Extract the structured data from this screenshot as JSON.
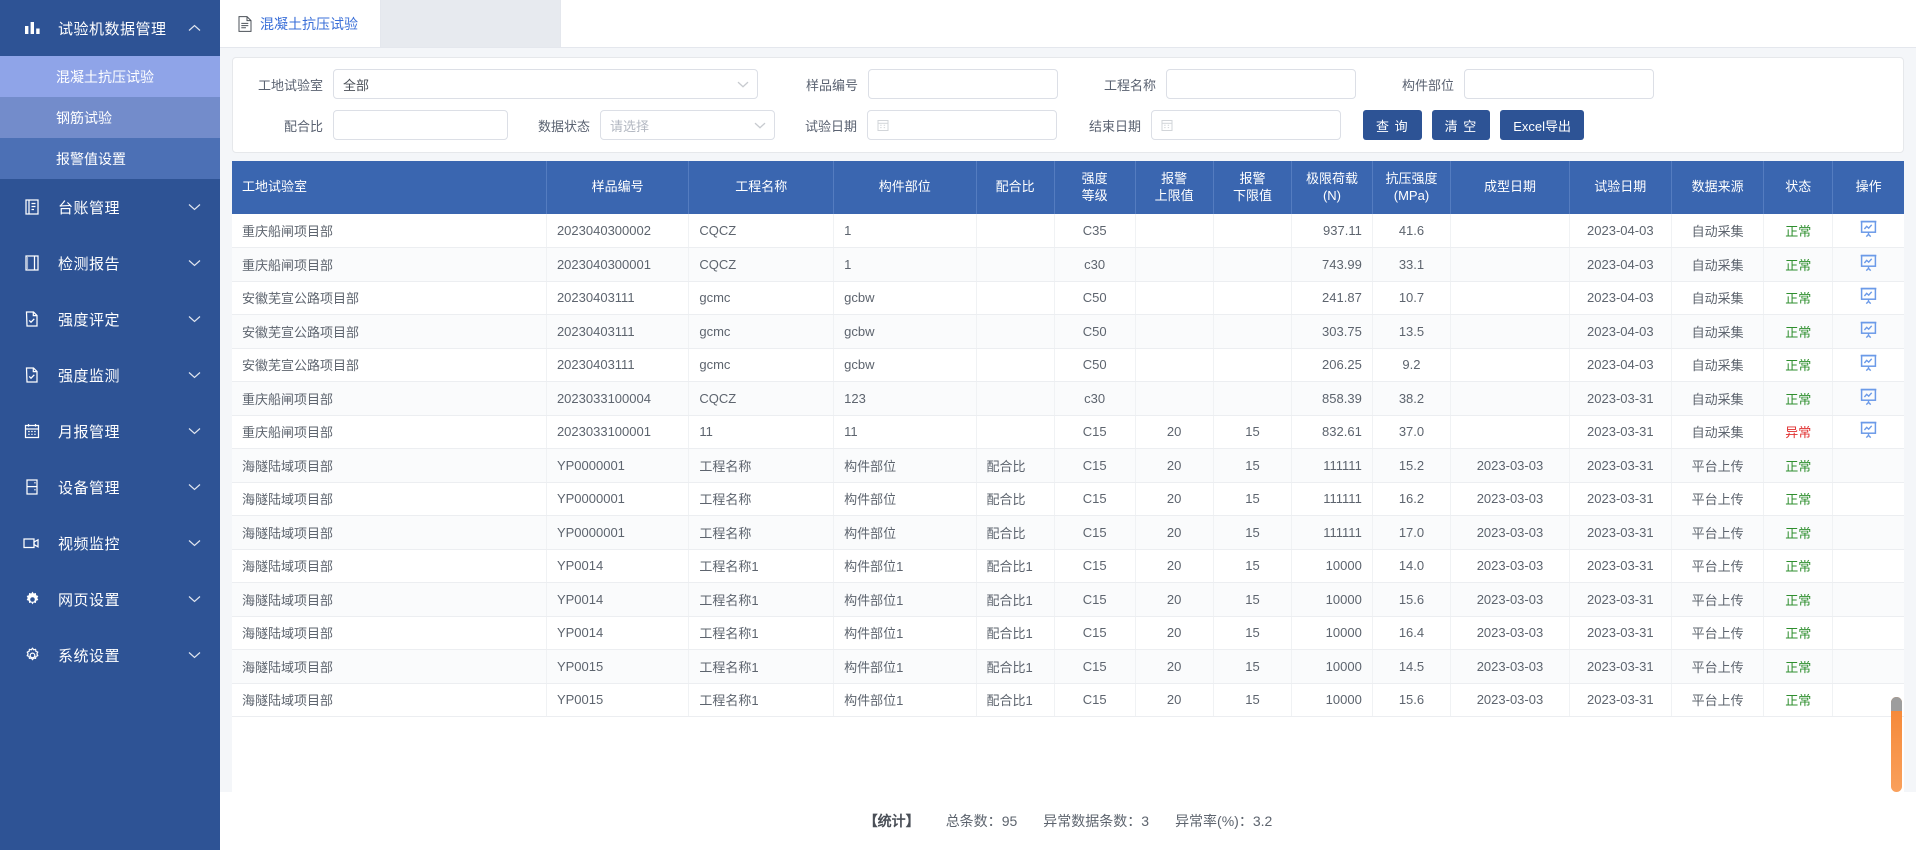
{
  "sidebar": {
    "groups": [
      {
        "icon": "chart-bar-icon",
        "label": "试验机数据管理",
        "expanded": true,
        "chevron": "up",
        "children": [
          {
            "label": "混凝土抗压试验",
            "selected": true
          },
          {
            "label": "钢筋试验",
            "selected": false
          },
          {
            "label": "报警值设置",
            "selected": false
          }
        ]
      },
      {
        "icon": "ledger-icon",
        "label": "台账管理",
        "expanded": false,
        "chevron": "down",
        "children": []
      },
      {
        "icon": "report-book-icon",
        "label": "检测报告",
        "expanded": false,
        "chevron": "down",
        "children": []
      },
      {
        "icon": "file-check-icon",
        "label": "强度评定",
        "expanded": false,
        "chevron": "down",
        "children": []
      },
      {
        "icon": "file-check-icon",
        "label": "强度监测",
        "expanded": false,
        "chevron": "down",
        "children": []
      },
      {
        "icon": "calendar-icon",
        "label": "月报管理",
        "expanded": false,
        "chevron": "down",
        "children": []
      },
      {
        "icon": "device-icon",
        "label": "设备管理",
        "expanded": false,
        "chevron": "down",
        "children": []
      },
      {
        "icon": "video-camera-icon",
        "label": "视频监控",
        "expanded": false,
        "chevron": "down",
        "children": []
      },
      {
        "icon": "gear-solid-icon",
        "label": "网页设置",
        "expanded": false,
        "chevron": "down",
        "children": []
      },
      {
        "icon": "gear-outline-icon",
        "label": "系统设置",
        "expanded": false,
        "chevron": "down",
        "children": []
      }
    ]
  },
  "tabs": [
    {
      "icon": "document-icon",
      "label": "混凝土抗压试验",
      "active": true
    }
  ],
  "search": {
    "lab_label": "工地试验室",
    "lab_value": "全部",
    "sample_label": "样品编号",
    "sample_value": "",
    "project_label": "工程名称",
    "project_value": "",
    "part_label": "构件部位",
    "part_value": "",
    "mix_label": "配合比",
    "mix_value": "",
    "status_label": "数据状态",
    "status_placeholder": "请选择",
    "test_date_label": "试验日期",
    "test_date_value": "",
    "end_date_label": "结束日期",
    "end_date_value": "",
    "btn_query": "查 询",
    "btn_clear": "清 空",
    "btn_export": "Excel导出"
  },
  "table": {
    "columns": [
      "工地试验室",
      "样品编号",
      "工程名称",
      "构件部位",
      "配合比",
      "强度\n等级",
      "报警\n上限值",
      "报警\n下限值",
      "极限荷载\n(N)",
      "抗压强度\n(MPa)",
      "成型日期",
      "试验日期",
      "数据来源",
      "状态",
      "操作"
    ],
    "rows": [
      {
        "lab": "重庆船闸项目部",
        "sample": "2023040300002",
        "project": "CQCZ",
        "part": "1",
        "mix": "",
        "grade": "C35",
        "upper": "",
        "lower": "",
        "load": "937.11",
        "strength": "41.6",
        "formed": "",
        "tested": "2023-04-03",
        "source": "自动采集",
        "status": "正常",
        "status_type": "ok",
        "action": "chart-board-icon"
      },
      {
        "lab": "重庆船闸项目部",
        "sample": "2023040300001",
        "project": "CQCZ",
        "part": "1",
        "mix": "",
        "grade": "c30",
        "upper": "",
        "lower": "",
        "load": "743.99",
        "strength": "33.1",
        "formed": "",
        "tested": "2023-04-03",
        "source": "自动采集",
        "status": "正常",
        "status_type": "ok",
        "action": "chart-board-icon"
      },
      {
        "lab": "安徽芜宣公路项目部",
        "sample": "20230403111",
        "project": "gcmc",
        "part": "gcbw",
        "mix": "",
        "grade": "C50",
        "upper": "",
        "lower": "",
        "load": "241.87",
        "strength": "10.7",
        "formed": "",
        "tested": "2023-04-03",
        "source": "自动采集",
        "status": "正常",
        "status_type": "ok",
        "action": "chart-board-icon"
      },
      {
        "lab": "安徽芜宣公路项目部",
        "sample": "20230403111",
        "project": "gcmc",
        "part": "gcbw",
        "mix": "",
        "grade": "C50",
        "upper": "",
        "lower": "",
        "load": "303.75",
        "strength": "13.5",
        "formed": "",
        "tested": "2023-04-03",
        "source": "自动采集",
        "status": "正常",
        "status_type": "ok",
        "action": "chart-board-icon"
      },
      {
        "lab": "安徽芜宣公路项目部",
        "sample": "20230403111",
        "project": "gcmc",
        "part": "gcbw",
        "mix": "",
        "grade": "C50",
        "upper": "",
        "lower": "",
        "load": "206.25",
        "strength": "9.2",
        "formed": "",
        "tested": "2023-04-03",
        "source": "自动采集",
        "status": "正常",
        "status_type": "ok",
        "action": "chart-board-icon"
      },
      {
        "lab": "重庆船闸项目部",
        "sample": "2023033100004",
        "project": "CQCZ",
        "part": "123",
        "mix": "",
        "grade": "c30",
        "upper": "",
        "lower": "",
        "load": "858.39",
        "strength": "38.2",
        "formed": "",
        "tested": "2023-03-31",
        "source": "自动采集",
        "status": "正常",
        "status_type": "ok",
        "action": "chart-board-icon"
      },
      {
        "lab": "重庆船闸项目部",
        "sample": "2023033100001",
        "project": "11",
        "part": "11",
        "mix": "",
        "grade": "C15",
        "upper": "20",
        "lower": "15",
        "load": "832.61",
        "strength": "37.0",
        "formed": "",
        "tested": "2023-03-31",
        "source": "自动采集",
        "status": "异常",
        "status_type": "bad",
        "action": "chart-board-icon"
      },
      {
        "lab": "海隧陆域项目部",
        "sample": "YP0000001",
        "project": "工程名称",
        "part": "构件部位",
        "mix": "配合比",
        "grade": "C15",
        "upper": "20",
        "lower": "15",
        "load": "111111",
        "strength": "15.2",
        "formed": "2023-03-03",
        "tested": "2023-03-31",
        "source": "平台上传",
        "status": "正常",
        "status_type": "ok",
        "action": ""
      },
      {
        "lab": "海隧陆域项目部",
        "sample": "YP0000001",
        "project": "工程名称",
        "part": "构件部位",
        "mix": "配合比",
        "grade": "C15",
        "upper": "20",
        "lower": "15",
        "load": "111111",
        "strength": "16.2",
        "formed": "2023-03-03",
        "tested": "2023-03-31",
        "source": "平台上传",
        "status": "正常",
        "status_type": "ok",
        "action": ""
      },
      {
        "lab": "海隧陆域项目部",
        "sample": "YP0000001",
        "project": "工程名称",
        "part": "构件部位",
        "mix": "配合比",
        "grade": "C15",
        "upper": "20",
        "lower": "15",
        "load": "111111",
        "strength": "17.0",
        "formed": "2023-03-03",
        "tested": "2023-03-31",
        "source": "平台上传",
        "status": "正常",
        "status_type": "ok",
        "action": ""
      },
      {
        "lab": "海隧陆域项目部",
        "sample": "YP0014",
        "project": "工程名称1",
        "part": "构件部位1",
        "mix": "配合比1",
        "grade": "C15",
        "upper": "20",
        "lower": "15",
        "load": "10000",
        "strength": "14.0",
        "formed": "2023-03-03",
        "tested": "2023-03-31",
        "source": "平台上传",
        "status": "正常",
        "status_type": "ok",
        "action": ""
      },
      {
        "lab": "海隧陆域项目部",
        "sample": "YP0014",
        "project": "工程名称1",
        "part": "构件部位1",
        "mix": "配合比1",
        "grade": "C15",
        "upper": "20",
        "lower": "15",
        "load": "10000",
        "strength": "15.6",
        "formed": "2023-03-03",
        "tested": "2023-03-31",
        "source": "平台上传",
        "status": "正常",
        "status_type": "ok",
        "action": ""
      },
      {
        "lab": "海隧陆域项目部",
        "sample": "YP0014",
        "project": "工程名称1",
        "part": "构件部位1",
        "mix": "配合比1",
        "grade": "C15",
        "upper": "20",
        "lower": "15",
        "load": "10000",
        "strength": "16.4",
        "formed": "2023-03-03",
        "tested": "2023-03-31",
        "source": "平台上传",
        "status": "正常",
        "status_type": "ok",
        "action": ""
      },
      {
        "lab": "海隧陆域项目部",
        "sample": "YP0015",
        "project": "工程名称1",
        "part": "构件部位1",
        "mix": "配合比1",
        "grade": "C15",
        "upper": "20",
        "lower": "15",
        "load": "10000",
        "strength": "14.5",
        "formed": "2023-03-03",
        "tested": "2023-03-31",
        "source": "平台上传",
        "status": "正常",
        "status_type": "ok",
        "action": ""
      },
      {
        "lab": "海隧陆域项目部",
        "sample": "YP0015",
        "project": "工程名称1",
        "part": "构件部位1",
        "mix": "配合比1",
        "grade": "C15",
        "upper": "20",
        "lower": "15",
        "load": "10000",
        "strength": "15.6",
        "formed": "2023-03-03",
        "tested": "2023-03-31",
        "source": "平台上传",
        "status": "正常",
        "status_type": "ok",
        "action": ""
      }
    ]
  },
  "footer": {
    "title": "【统计】",
    "total_label": "总条数：",
    "total_value": "95",
    "abnormal_label": "异常数据条数：",
    "abnormal_value": "3",
    "rate_label": "异常率(%)：",
    "rate_value": "3.2"
  },
  "colors": {
    "sidebar_bg": "#2e5395",
    "submenu_selected": "#8fa4e8",
    "table_header": "#3a66b0",
    "button": "#2d5395",
    "status_ok": "#2f8f2f",
    "status_bad": "#e03030",
    "tab_text": "#3a6fd8",
    "scrollbar": "#f58634"
  }
}
